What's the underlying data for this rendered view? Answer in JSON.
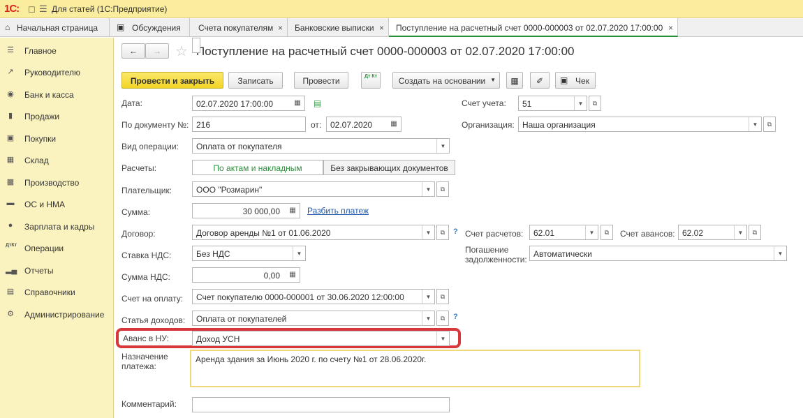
{
  "titlebar": {
    "logo": "1С:",
    "app_title": "Для статей  (1С:Предприятие)"
  },
  "tabs": [
    {
      "label": "Начальная страница"
    },
    {
      "label": "Обсуждения"
    },
    {
      "label": "Счета покупателям"
    },
    {
      "label": "Банковские выписки"
    },
    {
      "label": "Поступление на расчетный счет 0000-000003 от 02.07.2020 17:00:00"
    }
  ],
  "sidebar": {
    "items": [
      {
        "label": "Главное",
        "icon": "menu-icon"
      },
      {
        "label": "Руководителю",
        "icon": "chart-line-icon"
      },
      {
        "label": "Банк и касса",
        "icon": "coin-icon"
      },
      {
        "label": "Продажи",
        "icon": "bag-icon"
      },
      {
        "label": "Покупки",
        "icon": "cart-icon"
      },
      {
        "label": "Склад",
        "icon": "warehouse-icon"
      },
      {
        "label": "Производство",
        "icon": "factory-icon"
      },
      {
        "label": "ОС и НМА",
        "icon": "truck-icon"
      },
      {
        "label": "Зарплата и кадры",
        "icon": "person-icon"
      },
      {
        "label": "Операции",
        "icon": "dt-kt-icon"
      },
      {
        "label": "Отчеты",
        "icon": "bar-chart-icon"
      },
      {
        "label": "Справочники",
        "icon": "book-icon"
      },
      {
        "label": "Администрирование",
        "icon": "gear-icon"
      }
    ]
  },
  "doc": {
    "title": "Поступление на расчетный счет 0000-000003 от 02.07.2020 17:00:00"
  },
  "toolbar": {
    "post_close": "Провести и закрыть",
    "save": "Записать",
    "post": "Провести",
    "dtkt": "Дт Кт",
    "create_based": "Создать на основании",
    "check": "Чек"
  },
  "form": {
    "date_label": "Дата:",
    "date_value": "02.07.2020 17:00:00",
    "account_label": "Счет учета:",
    "account_value": "51",
    "doc_num_label": "По документу №:",
    "doc_num_value": "216",
    "from_label": "от:",
    "from_value": "02.07.2020",
    "org_label": "Организация:",
    "org_value": "Наша организация",
    "op_type_label": "Вид операции:",
    "op_type_value": "Оплата от покупателя",
    "settlements_label": "Расчеты:",
    "settle_opt1": "По актам и накладным",
    "settle_opt2": "Без закрывающих документов",
    "payer_label": "Плательщик:",
    "payer_value": "ООО \"Розмарин\"",
    "sum_label": "Сумма:",
    "sum_value": "30 000,00",
    "split_link": "Разбить платеж",
    "contract_label": "Договор:",
    "contract_value": "Договор аренды №1 от 01.06.2020",
    "settle_acc_label": "Счет расчетов:",
    "settle_acc_value": "62.01",
    "adv_acc_label": "Счет авансов:",
    "adv_acc_value": "62.02",
    "vat_rate_label": "Ставка НДС:",
    "vat_rate_value": "Без НДС",
    "repay_label_1": "Погашение",
    "repay_label_2": "задолженности:",
    "repay_value": "Автоматически",
    "vat_sum_label": "Сумма НДС:",
    "vat_sum_value": "0,00",
    "invoice_label": "Счет на оплату:",
    "invoice_value": "Счет покупателю 0000-000001 от 30.06.2020 12:00:00",
    "income_label": "Статья доходов:",
    "income_value": "Оплата от покупателей",
    "advance_label": "Аванс в НУ:",
    "advance_value": "Доход УСН",
    "purpose_label_1": "Назначение",
    "purpose_label_2": "платежа:",
    "purpose_value": "Аренда здания за Июнь 2020 г. по счету №1 от 28.06.2020г.",
    "comment_label": "Комментарий:",
    "comment_value": ""
  },
  "colors": {
    "titlebar_bg": "#fbed9e",
    "sidebar_bg": "#fbf3bf",
    "primary_button": "#f3d526",
    "highlight": "#d9363a",
    "accent_green": "#2a8f3a"
  }
}
